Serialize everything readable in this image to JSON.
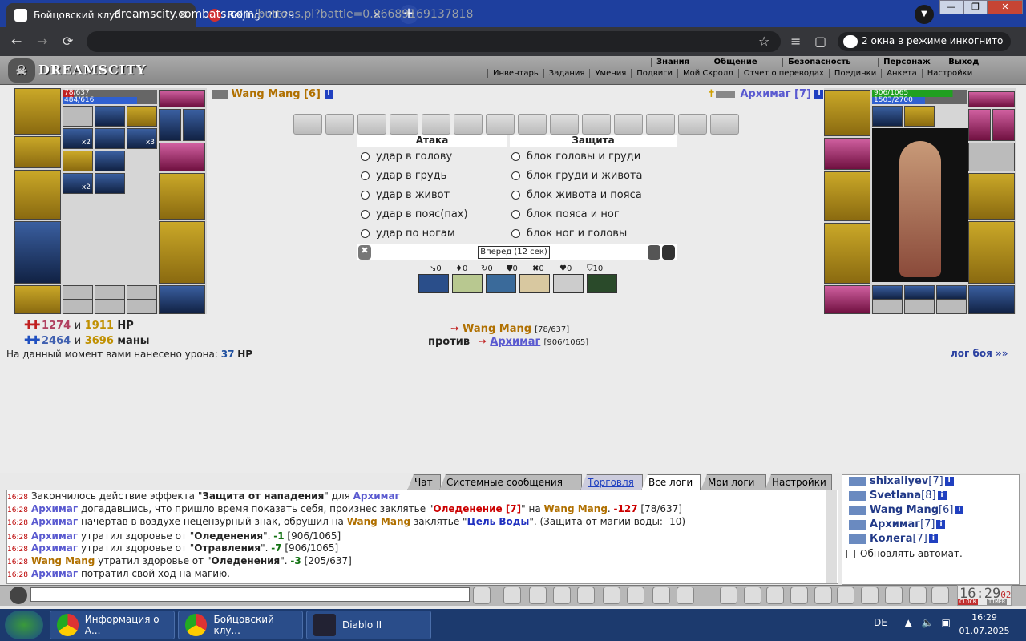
{
  "browser": {
    "tabs": [
      {
        "title": "Бойцовский клуб",
        "active": true
      },
      {
        "title": "Beijing: 21:29",
        "active": false
      }
    ],
    "url_host": "dreamscity.combats.com",
    "url_path": "/buttons.pl?battle=0.96689169137818",
    "incognito_label": "2 окна в режиме инкогнито",
    "new_tab": "+",
    "window_buttons": [
      "—",
      "❐",
      "✕"
    ],
    "nav_icons": [
      "←",
      "→",
      "⟳",
      "☆",
      "≡",
      "▢"
    ]
  },
  "site": {
    "logo": "DREAMSCITY",
    "top_menu": [
      "Знания",
      "Общение",
      "Безопасность",
      "Персонаж",
      "Выход"
    ],
    "sub_menu": [
      "Инвентарь",
      "Задания",
      "Умения",
      "Подвиги",
      "Мой Скролл",
      "Отчет о переводах",
      "Поединки",
      "Анкета",
      "Настройки"
    ]
  },
  "player": {
    "name": "Wang Mang [6]",
    "hp": "78/637",
    "mana": "484/616",
    "hp_frac": 0.12,
    "mana_frac": 0.79
  },
  "enemy": {
    "name": "Архимаг [7]",
    "hp": "906/1065",
    "mana": "1503/2700",
    "hp_frac": 0.85,
    "mana_frac": 0.56
  },
  "battle": {
    "attack_title": "Атака",
    "defense_title": "Защита",
    "attacks": [
      "удар в голову",
      "удар в грудь",
      "удар в живот",
      "удар в пояс(пах)",
      "удар по ногам"
    ],
    "defenses": [
      "блок головы и груди",
      "блок груди и живота",
      "блок живота и пояса",
      "блок пояса и ног",
      "блок ног и головы"
    ],
    "forward_label": "Вперед (12 сек)",
    "stats": [
      "↘0",
      "♦0",
      "↻0",
      "⛊0",
      "✖0",
      "♥0",
      "⛉10"
    ],
    "slot_counts": [
      "x2",
      "x3",
      "x2"
    ],
    "info_glyph": "i"
  },
  "summary": {
    "hp_a": "1274",
    "and": "и",
    "hp_b": "1911",
    "hp_label": "HP",
    "mana_a": "2464",
    "mana_b": "3696",
    "mana_label": "маны",
    "damage_text": "На данный момент вами нанесено урона:",
    "damage_value": "37",
    "damage_unit": "HP",
    "fighter1": "Wang Mang",
    "fighter1_hp": "[78/637]",
    "versus": "против",
    "fighter2": "Архимаг",
    "fighter2_hp": "[906/1065]",
    "log_link": "лог боя »»"
  },
  "log_tabs": [
    "Чат",
    "Системные сообщения",
    "Торговля",
    "Все логи",
    "Мои логи",
    "Настройки"
  ],
  "log": [
    {
      "t": "16:28",
      "parts": [
        [
          "Закончилось действие эффекта \"",
          ""
        ],
        [
          "Защита от нападения",
          "b"
        ],
        [
          "\" для ",
          ""
        ],
        [
          "Архимаг",
          "nm1"
        ]
      ]
    },
    {
      "t": "16:28",
      "parts": [
        [
          "Архимаг",
          "nm1"
        ],
        [
          " догадавшись, что пришло время показать себя, произнес заклятье \"",
          ""
        ],
        [
          "Оледенение [7]",
          "sp"
        ],
        [
          "\" на ",
          ""
        ],
        [
          "Wang Mang",
          "nm2"
        ],
        [
          ". ",
          ""
        ],
        [
          "-127",
          "dmg"
        ],
        [
          " [78/637]",
          ""
        ]
      ]
    },
    {
      "t": "16:28",
      "parts": [
        [
          "Архимаг",
          "nm1"
        ],
        [
          " начертав в воздухе нецензурный знак, обрушил на ",
          ""
        ],
        [
          "Wang Mang",
          "nm2"
        ],
        [
          " заклятье \"",
          ""
        ],
        [
          "Цель Воды",
          "sp2"
        ],
        [
          "\". (Защита от магии воды: -10)",
          ""
        ]
      ]
    },
    {
      "t": "16:28",
      "parts": [
        [
          "Архимаг",
          "nm1"
        ],
        [
          " утратил здоровье от \"",
          ""
        ],
        [
          "Оледенения",
          "b"
        ],
        [
          "\". ",
          ""
        ],
        [
          "-1",
          "g"
        ],
        [
          " [906/1065]",
          ""
        ]
      ]
    },
    {
      "t": "16:28",
      "parts": [
        [
          "Архимаг",
          "nm1"
        ],
        [
          " утратил здоровье от \"",
          ""
        ],
        [
          "Отравления",
          "b"
        ],
        [
          "\". ",
          ""
        ],
        [
          "-7",
          "g"
        ],
        [
          " [906/1065]",
          ""
        ]
      ]
    },
    {
      "t": "16:28",
      "parts": [
        [
          "Wang Mang",
          "nm2"
        ],
        [
          " утратил здоровье от \"",
          ""
        ],
        [
          "Оледенения",
          "b"
        ],
        [
          "\". ",
          ""
        ],
        [
          "-3",
          "g"
        ],
        [
          " [205/637]",
          ""
        ]
      ]
    },
    {
      "t": "16:28",
      "parts": [
        [
          "Архимаг",
          "nm1"
        ],
        [
          " потратил свой ход на магию.",
          ""
        ]
      ]
    }
  ],
  "users": [
    {
      "name": "shixaliyev",
      "lvl": "[7]"
    },
    {
      "name": "Svetlana",
      "lvl": "[8]"
    },
    {
      "name": "Wang Mang",
      "lvl": "[6]"
    },
    {
      "name": "Архимаг",
      "lvl": "[7]"
    },
    {
      "name": "Колега",
      "lvl": "[7]"
    }
  ],
  "auto_refresh": "Обновлять автомат.",
  "game_clock": "16:29",
  "game_clock_sec": "02",
  "clock_labels": [
    "CLOCK",
    "TIMER"
  ],
  "taskbar": {
    "items": [
      "Информация о А...",
      "Бойцовский клу...",
      "Diablo II"
    ],
    "lang": "DE",
    "time": "16:29",
    "date": "01.07.2025"
  },
  "colors": {
    "accent": "#1e3f9e",
    "enemy_name": "#5a5ad0",
    "player_name": "#b07000",
    "damage": "#c00000"
  }
}
